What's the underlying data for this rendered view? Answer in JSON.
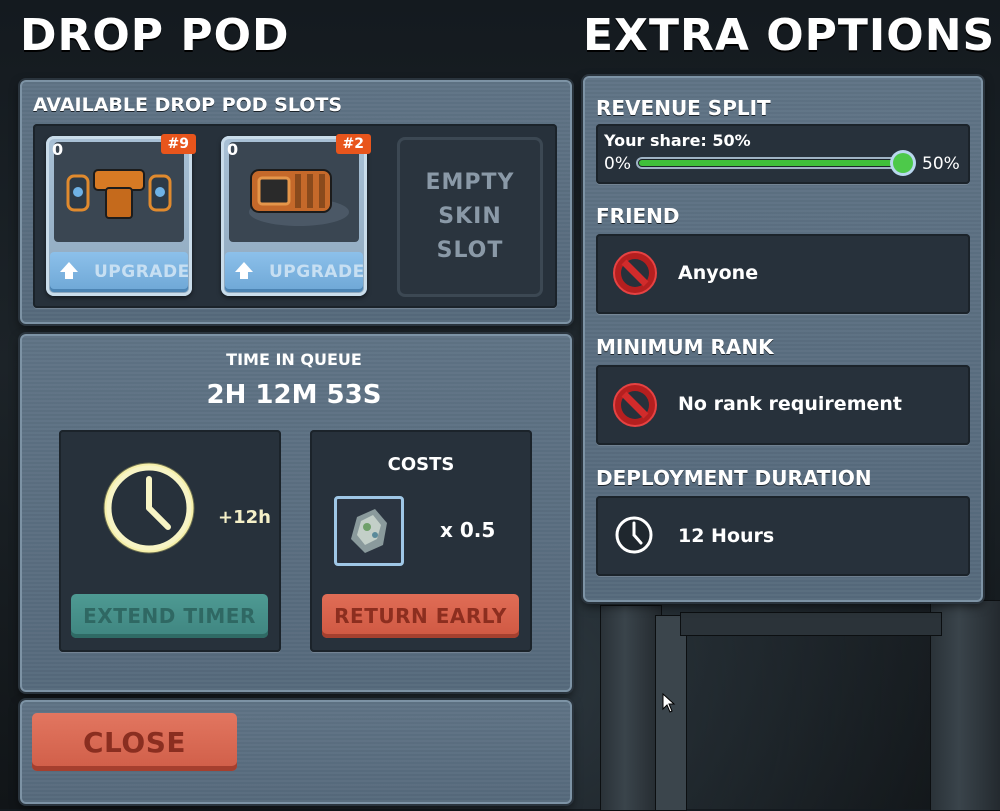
{
  "left_title": "DROP POD",
  "right_title": "EXTRA OPTIONS",
  "slots_section": {
    "label": "AVAILABLE DROP POD SLOTS",
    "slots": [
      {
        "count": "0",
        "badge": "#9",
        "upgrade_label": "UPGRADE",
        "icon": "mech-armor-skin-icon"
      },
      {
        "count": "0",
        "badge": "#2",
        "upgrade_label": "UPGRADE",
        "icon": "drop-pod-skin-icon"
      }
    ],
    "empty_slot_label": "EMPTY\nSKIN\nSLOT"
  },
  "queue": {
    "label": "TIME IN QUEUE",
    "time": "2H 12M 53S",
    "extend": {
      "bonus": "+12h",
      "button": "EXTEND TIMER",
      "icon": "clock-icon"
    },
    "costs": {
      "label": "COSTS",
      "multiplier": "x 0.5",
      "icon": "crystal-resource-icon",
      "button": "RETURN EARLY"
    }
  },
  "close_button": "CLOSE",
  "options": {
    "revenue": {
      "label": "REVENUE SPLIT",
      "share_text": "Your share: 50%",
      "min": "0%",
      "max": "50%",
      "value_fraction": 1.0
    },
    "friend": {
      "label": "FRIEND",
      "value": "Anyone",
      "icon": "no-entry-icon"
    },
    "rank": {
      "label": "MINIMUM RANK",
      "value": "No rank requirement",
      "icon": "no-entry-icon"
    },
    "duration": {
      "label": "DEPLOYMENT DURATION",
      "value": "12 Hours",
      "icon": "clock-icon"
    }
  },
  "colors": {
    "accent_green": "#3fbf3a",
    "badge_orange": "#e8551c",
    "button_red": "#d8624b",
    "button_teal": "#48908a"
  }
}
